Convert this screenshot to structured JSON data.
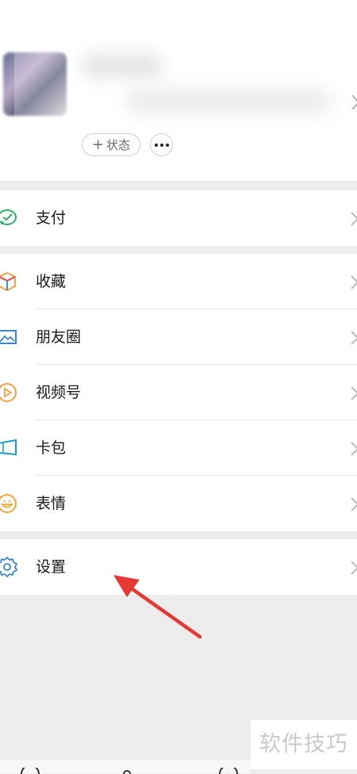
{
  "profile": {
    "status_label": "状态",
    "status_plus": "+"
  },
  "menu": {
    "groups": [
      {
        "items": [
          {
            "label": "支付",
            "icon": "wechat-pay-icon"
          }
        ]
      },
      {
        "items": [
          {
            "label": "收藏",
            "icon": "favorites-cube-icon"
          },
          {
            "label": "朋友圈",
            "icon": "moments-photo-icon"
          },
          {
            "label": "视频号",
            "icon": "channels-play-icon"
          },
          {
            "label": "卡包",
            "icon": "card-wallet-icon"
          },
          {
            "label": "表情",
            "icon": "sticker-smile-icon"
          }
        ]
      },
      {
        "items": [
          {
            "label": "设置",
            "icon": "settings-gear-icon"
          }
        ]
      }
    ]
  },
  "watermark": "软件技巧",
  "colors": {
    "pay_green": "#2aae67",
    "annotation_red": "#e53935",
    "channels_orange": "#f0a040",
    "card_teal": "#1aa0c8",
    "moments_blue": "#3b86c6"
  }
}
